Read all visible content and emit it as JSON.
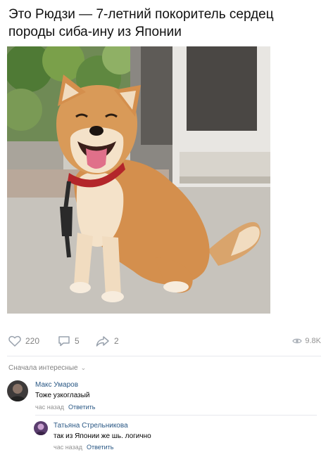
{
  "post": {
    "title": "Это Рюдзи — 7-летний покоритель сердец породы сиба-ину из Японии",
    "image_alt": "Smiling Shiba Inu dog sitting on pavement"
  },
  "actions": {
    "likes": "220",
    "comments": "5",
    "shares": "2",
    "views": "9.8K"
  },
  "comments_section": {
    "sort_label": "Сначала интересные"
  },
  "comments": [
    {
      "author": "Макс Умаров",
      "text": "Тоже узкоглазый",
      "time": "час назад",
      "reply_label": "Ответить"
    },
    {
      "author": "Татьяна Стрельникова",
      "text": "так из Японии же шь. логично",
      "time": "час назад",
      "reply_label": "Ответить"
    }
  ],
  "colors": {
    "link": "#2a5885",
    "muted": "#828282",
    "divider": "#e7e8ec"
  }
}
